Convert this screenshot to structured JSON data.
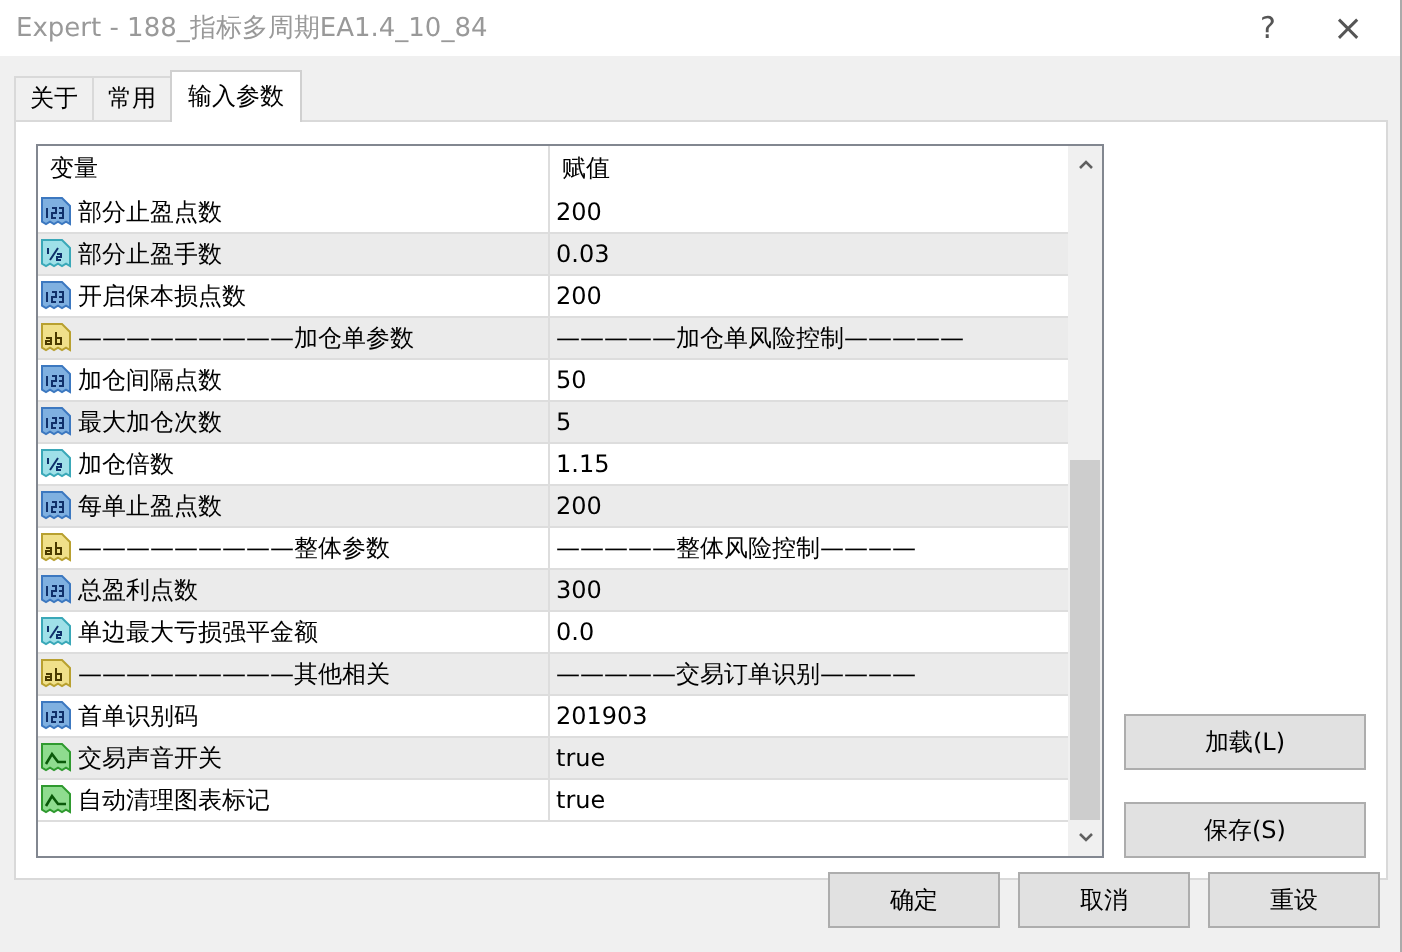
{
  "window": {
    "title": "Expert - 188_指标多周期EA1.4_10_84",
    "help": "?",
    "close": "×"
  },
  "tabs": [
    {
      "label": "关于",
      "selected": false
    },
    {
      "label": "常用",
      "selected": false
    },
    {
      "label": "输入参数",
      "selected": true
    }
  ],
  "table": {
    "columns": [
      "变量",
      "赋值"
    ],
    "rows": [
      {
        "kind": "int",
        "name": "部分止盈点数",
        "value": "200"
      },
      {
        "kind": "double",
        "name": "部分止盈手数",
        "value": "0.03"
      },
      {
        "kind": "int",
        "name": "开启保本损点数",
        "value": "200"
      },
      {
        "kind": "string",
        "name": "—————————加仓单参数",
        "value": "—————加仓单风险控制—————"
      },
      {
        "kind": "int",
        "name": "加仓间隔点数",
        "value": "50"
      },
      {
        "kind": "int",
        "name": "最大加仓次数",
        "value": "5"
      },
      {
        "kind": "double",
        "name": "加仓倍数",
        "value": "1.15"
      },
      {
        "kind": "int",
        "name": "每单止盈点数",
        "value": "200"
      },
      {
        "kind": "string",
        "name": "—————————整体参数",
        "value": "—————整体风险控制————"
      },
      {
        "kind": "int",
        "name": "总盈利点数",
        "value": "300"
      },
      {
        "kind": "double",
        "name": "单边最大亏损强平金额",
        "value": "0.0"
      },
      {
        "kind": "string",
        "name": "—————————其他相关",
        "value": "—————交易订单识别————"
      },
      {
        "kind": "int",
        "name": "首单识别码",
        "value": "201903"
      },
      {
        "kind": "bool",
        "name": "交易声音开关",
        "value": "true"
      },
      {
        "kind": "bool",
        "name": "自动清理图表标记",
        "value": "true"
      }
    ]
  },
  "side_buttons": [
    "加载(L)",
    "保存(S)"
  ],
  "buttons": [
    "确定",
    "取消",
    "重设"
  ]
}
